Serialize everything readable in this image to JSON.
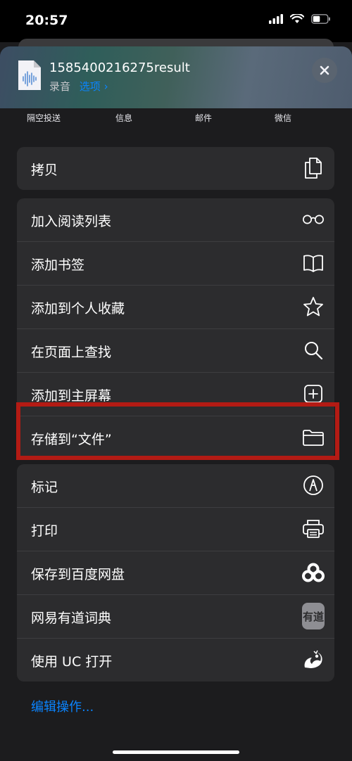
{
  "status": {
    "time": "20:57"
  },
  "header": {
    "file_name": "1585400216275result",
    "file_type": "录音",
    "options_label": "选项 ›"
  },
  "share_targets": [
    {
      "label": "隔空投送"
    },
    {
      "label": "信息"
    },
    {
      "label": "邮件"
    },
    {
      "label": "微信"
    }
  ],
  "groups": {
    "copy": [
      {
        "label": "拷贝",
        "icon": "copy-icon"
      }
    ],
    "actions": [
      {
        "label": "加入阅读列表",
        "icon": "glasses-icon"
      },
      {
        "label": "添加书签",
        "icon": "book-icon"
      },
      {
        "label": "添加到个人收藏",
        "icon": "star-icon"
      },
      {
        "label": "在页面上查找",
        "icon": "search-icon"
      },
      {
        "label": "添加到主屏幕",
        "icon": "add-square-icon"
      },
      {
        "label": "存储到“文件”",
        "icon": "folder-icon"
      }
    ],
    "extensions": [
      {
        "label": "标记",
        "icon": "markup-icon"
      },
      {
        "label": "打印",
        "icon": "printer-icon"
      },
      {
        "label": "保存到百度网盘",
        "icon": "baidu-netdisk-icon"
      },
      {
        "label": "网易有道词典",
        "icon": "youdao-icon",
        "icon_text": "有道"
      },
      {
        "label": "使用 UC 打开",
        "icon": "uc-browser-icon"
      }
    ]
  },
  "footer": {
    "edit_actions": "编辑操作..."
  },
  "colors": {
    "accent": "#0a84ff",
    "highlight": "#b31b14",
    "row_bg": "#2c2c2e",
    "sheet_bg": "#1c1c1e"
  }
}
